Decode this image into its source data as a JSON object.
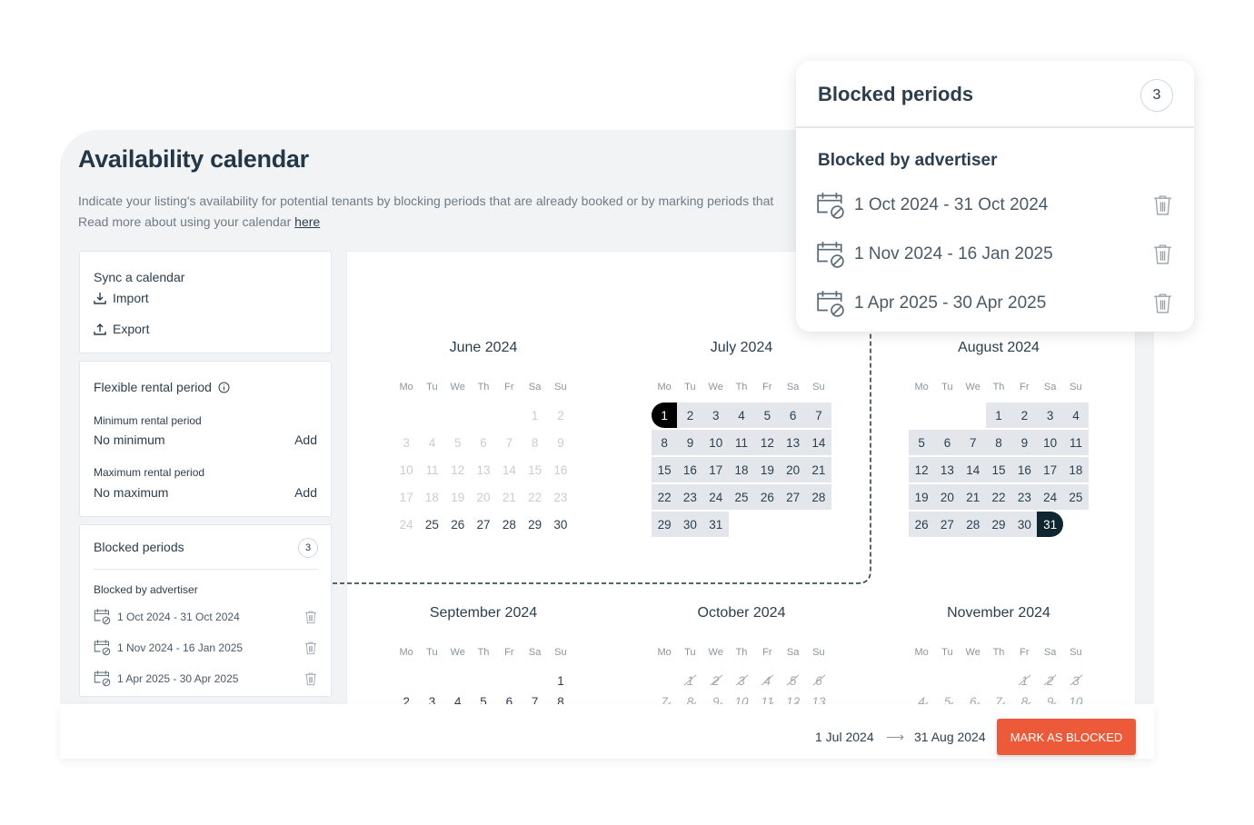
{
  "page": {
    "title": "Availability calendar",
    "intro_line1": "Indicate your listing's availability for potential tenants by blocking periods that are already booked or by marking periods that",
    "intro_line2": "Read more about using your calendar ",
    "intro_link": "here"
  },
  "sync": {
    "title": "Sync a calendar",
    "import": "Import",
    "export": "Export"
  },
  "flexible": {
    "title": "Flexible rental period",
    "min_label": "Minimum rental period",
    "min_value": "No minimum",
    "max_label": "Maximum rental period",
    "max_value": "No maximum",
    "add": "Add"
  },
  "blocked": {
    "title": "Blocked periods",
    "count": "3",
    "subtitle": "Blocked by advertiser",
    "items": [
      {
        "label": "1 Oct 2024 - 31 Oct 2024"
      },
      {
        "label": "1 Nov 2024 - 16 Jan 2025"
      },
      {
        "label": "1 Apr 2025 - 30 Apr 2025"
      }
    ]
  },
  "weekdays": [
    "Mo",
    "Tu",
    "We",
    "Th",
    "Fr",
    "Sa",
    "Su"
  ],
  "months": [
    {
      "title": "June 2024",
      "first_weekday": "Sa",
      "days": 30,
      "past_until": 24
    },
    {
      "title": "July 2024",
      "first_weekday": "Mo",
      "days": 31,
      "selected": true,
      "range_start": 1
    },
    {
      "title": "August 2024",
      "first_weekday": "Th",
      "days": 31,
      "selected": true,
      "range_end": 31
    },
    {
      "title": "September 2024",
      "first_weekday": "Su",
      "days": 30
    },
    {
      "title": "October 2024",
      "first_weekday": "Tu",
      "days": 31,
      "blocked": true
    },
    {
      "title": "November 2024",
      "first_weekday": "Fr",
      "days": 30,
      "blocked": true
    }
  ],
  "footer": {
    "start": "1 Jul 2024",
    "arrow": "⟶",
    "end": "31 Aug 2024",
    "button": "MARK AS BLOCKED"
  },
  "colors": {
    "accent": "#ec5a3a",
    "selected": "#e3e7eb",
    "range_end": "#000000",
    "text": "#2c3e4d"
  }
}
